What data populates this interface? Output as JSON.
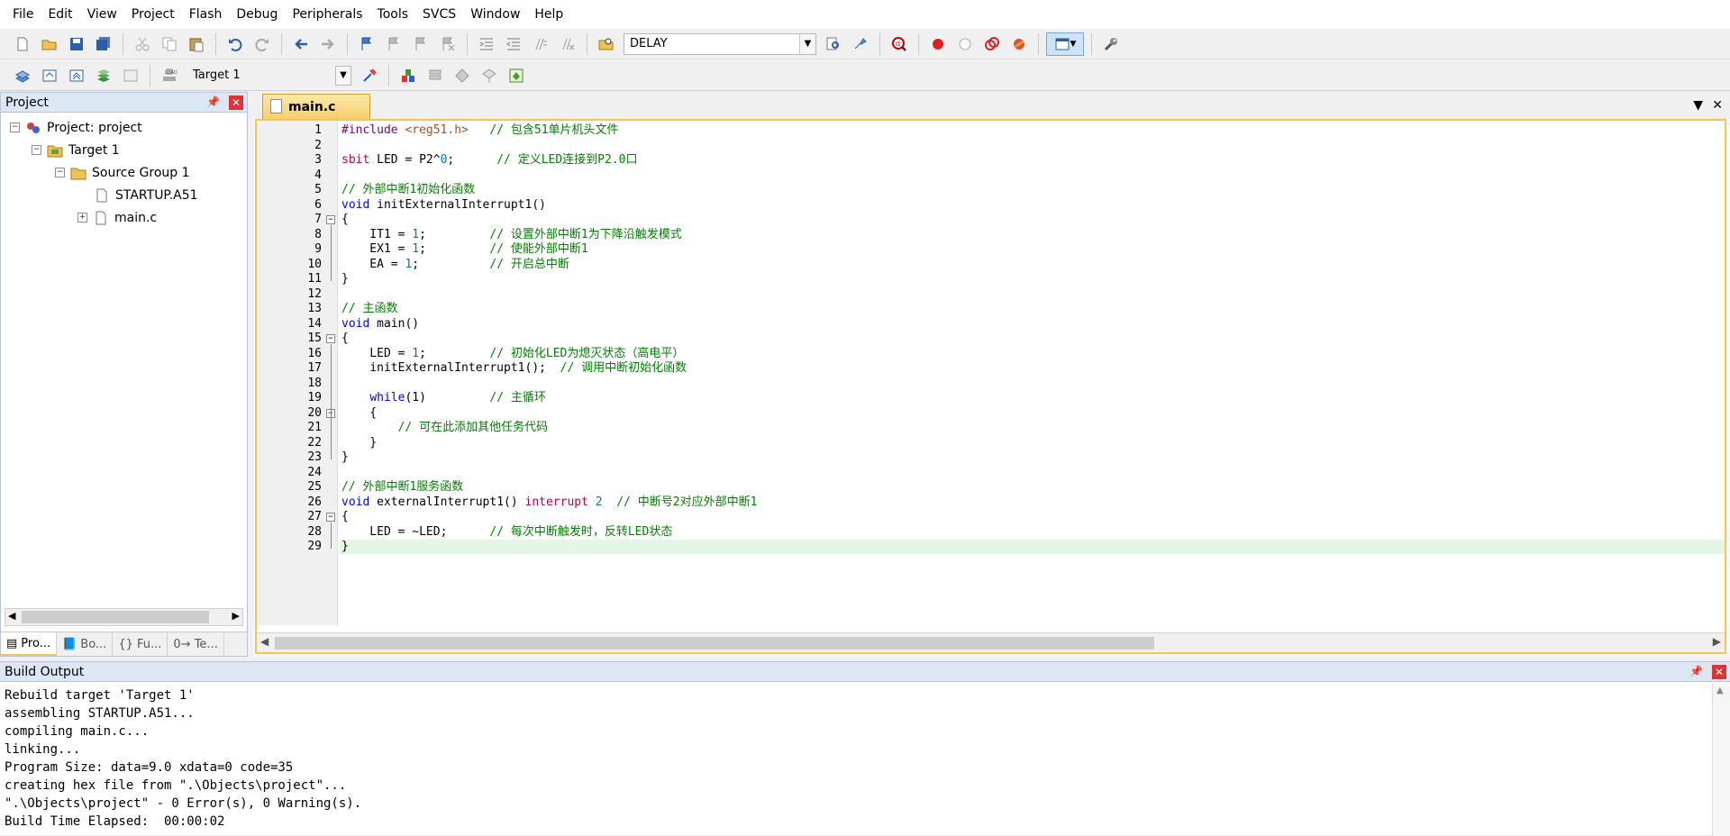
{
  "menu": [
    "File",
    "Edit",
    "View",
    "Project",
    "Flash",
    "Debug",
    "Peripherals",
    "Tools",
    "SVCS",
    "Window",
    "Help"
  ],
  "toolbar1": {
    "find_combo_value": "DELAY"
  },
  "toolbar2": {
    "target_combo_value": "Target 1"
  },
  "project_panel": {
    "title": "Project",
    "tree": [
      {
        "label": "Project: project",
        "level": 0,
        "expander": "-"
      },
      {
        "label": "Target 1",
        "level": 1,
        "expander": "-"
      },
      {
        "label": "Source Group 1",
        "level": 2,
        "expander": "-"
      },
      {
        "label": "STARTUP.A51",
        "level": 3,
        "expander": ""
      },
      {
        "label": "main.c",
        "level": 3,
        "expander": "+"
      }
    ],
    "tabs": [
      "Pro...",
      "Bo...",
      "{} Fu...",
      "0→ Te..."
    ]
  },
  "editor": {
    "tab_label": "main.c",
    "current_line": 29,
    "lines": [
      "#include <reg51.h>   // 包含51单片机头文件",
      "",
      "sbit LED = P2^0;      // 定义LED连接到P2.0口",
      "",
      "// 外部中断1初始化函数",
      "void initExternalInterrupt1()",
      "{",
      "    IT1 = 1;         // 设置外部中断1为下降沿触发模式",
      "    EX1 = 1;         // 使能外部中断1",
      "    EA = 1;          // 开启总中断",
      "}",
      "",
      "// 主函数",
      "void main()",
      "{",
      "    LED = 1;         // 初始化LED为熄灭状态（高电平）",
      "    initExternalInterrupt1();  // 调用中断初始化函数",
      "",
      "    while(1)         // 主循环",
      "    {",
      "        // 可在此添加其他任务代码",
      "    }",
      "}",
      "",
      "// 外部中断1服务函数",
      "void externalInterrupt1() interrupt 2  // 中断号2对应外部中断1",
      "{",
      "    LED = ~LED;      // 每次中断触发时，反转LED状态",
      "}"
    ]
  },
  "build_output": {
    "title": "Build Output",
    "lines": [
      "Rebuild target 'Target 1'",
      "assembling STARTUP.A51...",
      "compiling main.c...",
      "linking...",
      "Program Size: data=9.0 xdata=0 code=35",
      "creating hex file from \".\\Objects\\project\"...",
      "\".\\Objects\\project\" - 0 Error(s), 0 Warning(s).",
      "Build Time Elapsed:  00:00:02"
    ]
  },
  "icons": {
    "toolbar1": [
      "new-file-icon",
      "open-folder-icon",
      "save-icon",
      "save-all-icon",
      "cut-icon",
      "copy-icon",
      "paste-icon",
      "undo-icon",
      "redo-icon",
      "navigate-back-icon",
      "navigate-forward-icon",
      "bookmark-icon",
      "prev-bookmark-icon",
      "next-bookmark-icon",
      "clear-bookmarks-icon",
      "indent-icon",
      "unindent-icon",
      "comment-icon",
      "uncomment-icon",
      "find-in-files-icon",
      "find-icon",
      "incremental-find-icon",
      "debug-session-icon",
      "breakpoint-icon",
      "disable-breakpoint-icon",
      "disable-all-breakpoints-icon",
      "kill-all-breakpoints-icon",
      "window-layout-icon",
      "configure-icon"
    ],
    "toolbar2": [
      "translate-icon",
      "build-icon",
      "rebuild-icon",
      "batch-build-icon",
      "stop-build-icon",
      "download-icon",
      "target-options-icon",
      "manage-project-icon",
      "file-extensions-icon",
      "select-packs-icon",
      "manage-rte-icon"
    ]
  }
}
